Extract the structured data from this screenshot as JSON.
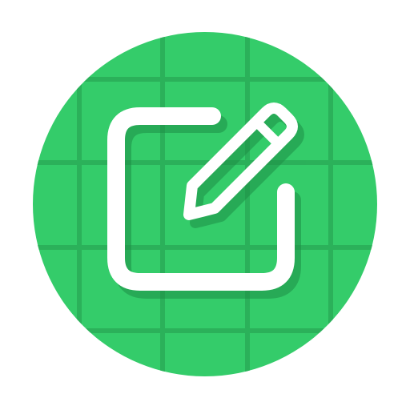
{
  "icon": {
    "name": "edit-note-icon",
    "background_color": "#34CC6A",
    "grid_color": "#2BAE59",
    "glyph_color": "#FFFFFF",
    "shadow_color": "#1E8E45"
  }
}
